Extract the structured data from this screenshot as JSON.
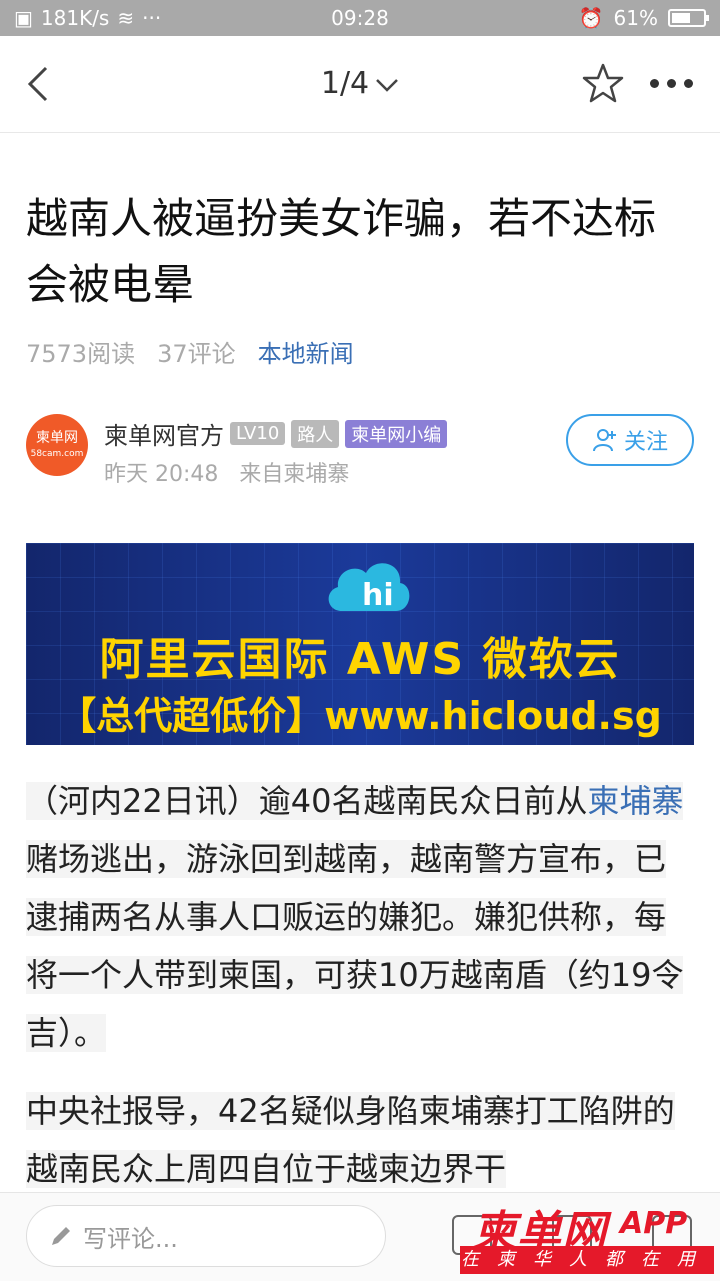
{
  "status": {
    "speed": "181K/s",
    "time": "09:28",
    "battery": "61%",
    "battery_level": 0.61
  },
  "nav": {
    "pager": "1/4"
  },
  "article": {
    "title": "越南人被逼扮美女诈骗，若不达标会被电晕",
    "reads": "7573阅读",
    "comments": "37评论",
    "category": "本地新闻"
  },
  "author": {
    "name": "柬单网官方",
    "badges": [
      "LV10",
      "路人",
      "柬单网小编"
    ],
    "time": "昨天 20:48",
    "source": "来自柬埔寨",
    "avatar_text": "柬单网",
    "avatar_sub": "58cam.com",
    "follow": "关注"
  },
  "banner": {
    "line1": "阿里云国际  AWS  微软云",
    "line2": "【总代超低价】www.hicloud.sg"
  },
  "body": {
    "p1_a": "（河内22日讯）逾40名越南民众日前从",
    "p1_link": "柬埔寨",
    "p1_b": "赌场逃出，游泳回到越南，越南警方宣布，已逮捕两名从事人口贩运的嫌犯。嫌犯供称，每将一个人带到柬国，可获10万越南盾（约19令吉）。",
    "p2": "中央社报导，42名疑似身陷柬埔寨打工陷阱的越南民众上周四自位于越柬边界干"
  },
  "bottom": {
    "comment_placeholder": "写评论...",
    "logo": "柬单网",
    "logo_app": "APP",
    "slogan": "在柬华人都在用"
  }
}
